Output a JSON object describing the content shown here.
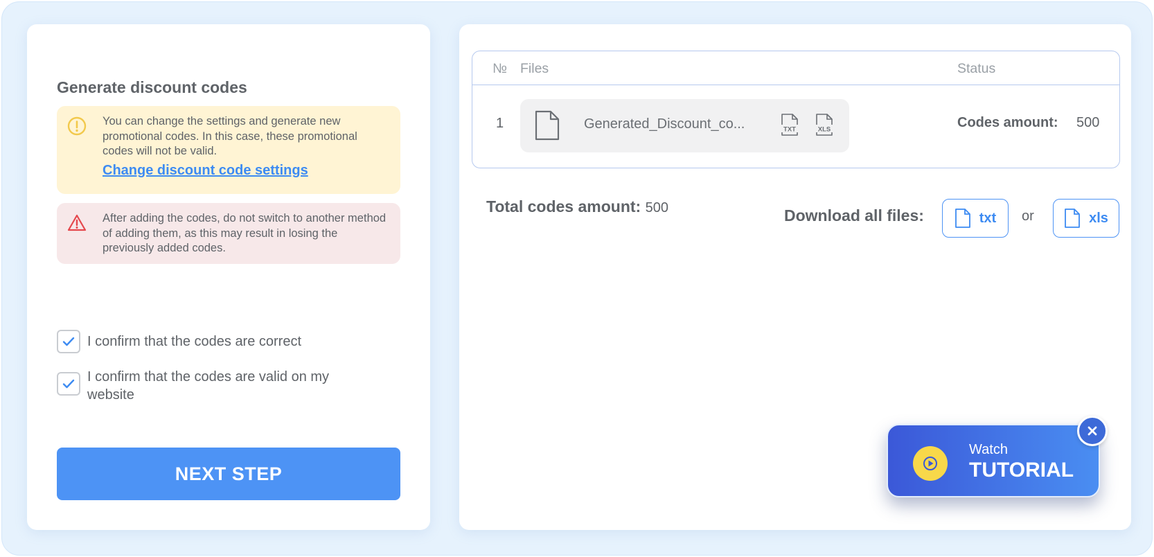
{
  "left_panel": {
    "title": "Generate discount codes",
    "info_alert": {
      "icon": "exclamation-circle-icon",
      "text": "You can change the settings and generate new promotional codes. In this case, these promotional codes will not be valid.",
      "link_label": "Change discount code settings"
    },
    "warning_alert": {
      "icon": "warning-triangle-icon",
      "text": "After adding the codes, do not switch to another method of adding them, as this may result in losing the previously added codes."
    },
    "checkboxes": [
      {
        "label": "I confirm that the codes are correct",
        "checked": true
      },
      {
        "label": "I confirm that the codes are valid on my website",
        "checked": true
      }
    ],
    "next_button_label": "NEXT STEP"
  },
  "right_panel": {
    "table": {
      "headers": {
        "no": "№",
        "files": "Files",
        "status": "Status"
      },
      "rows": [
        {
          "no": "1",
          "file_name": "Generated_Discount_co...",
          "formats": [
            "TXT",
            "XLS"
          ],
          "status_label": "Codes amount:",
          "status_value": "500"
        }
      ]
    },
    "total_label": "Total codes amount:",
    "total_value": "500",
    "download_label": "Download all files:",
    "download_txt": "txt",
    "download_or": "or",
    "download_xls": "xls"
  },
  "tutorial": {
    "watch": "Watch",
    "title": "TUTORIAL"
  },
  "colors": {
    "accent": "#4d93f5",
    "info_bg": "#fff4d4",
    "warning_bg": "#f7e8e9",
    "warning_icon": "#e5484d",
    "info_icon": "#f2c94c",
    "background": "#e6f2fd"
  }
}
